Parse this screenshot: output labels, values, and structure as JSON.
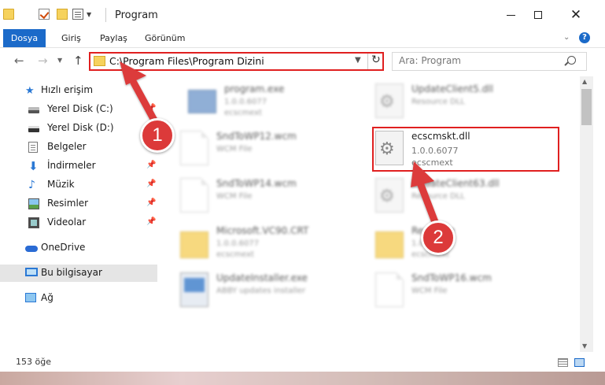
{
  "window": {
    "title": "Program"
  },
  "ribbon": {
    "tabs": [
      "Dosya",
      "Giriş",
      "Paylaş",
      "Görünüm"
    ]
  },
  "address": {
    "path": "C:\\Program Files\\Program Dizini"
  },
  "search": {
    "placeholder": "Ara: Program"
  },
  "sidebar": {
    "items": [
      {
        "label": "Hızlı erişim",
        "icon": "star-icon"
      },
      {
        "label": "Yerel Disk (C:)",
        "icon": "disk-icon"
      },
      {
        "label": "Yerel Disk (D:)",
        "icon": "disk-icon"
      },
      {
        "label": "Belgeler",
        "icon": "documents-icon"
      },
      {
        "label": "İndirmeler",
        "icon": "downloads-icon"
      },
      {
        "label": "Müzik",
        "icon": "music-icon"
      },
      {
        "label": "Resimler",
        "icon": "pictures-icon"
      },
      {
        "label": "Videolar",
        "icon": "videos-icon"
      },
      {
        "label": "OneDrive",
        "icon": "cloud-icon"
      },
      {
        "label": "Bu bilgisayar",
        "icon": "computer-icon"
      },
      {
        "label": "Ağ",
        "icon": "network-icon"
      }
    ]
  },
  "files": [
    {
      "name": "program.exe",
      "line2": "1.0.0.6077",
      "line3": "ecscmext"
    },
    {
      "name": "UpdateClient5.dll",
      "line2": "Resource DLL",
      "line3": ""
    },
    {
      "name": "SndToWP12.wcm",
      "line2": "WCM File",
      "line3": ""
    },
    {
      "name": "ecscmskt.dll",
      "line2": "1.0.0.6077",
      "line3": "ecscmext"
    },
    {
      "name": "SndToWP14.wcm",
      "line2": "WCM File",
      "line3": ""
    },
    {
      "name": "UpdateClient63.dll",
      "line2": "Resource DLL",
      "line3": ""
    },
    {
      "name": "Microsoft.VC90.CRT",
      "line2": "1.0.0.6077",
      "line3": "ecscmext"
    },
    {
      "name": "Resource",
      "line2": "1.0.0.6077",
      "line3": "ecscmext"
    },
    {
      "name": "UpdateInstaller.exe",
      "line2": "ABBY updates installer",
      "line3": ""
    },
    {
      "name": "SndToWP16.wcm",
      "line2": "WCM File",
      "line3": ""
    }
  ],
  "status": {
    "item_count": "153 öğe"
  },
  "annotations": {
    "step1": "1",
    "step2": "2"
  },
  "colors": {
    "accent": "#1b6ac9",
    "highlight": "#e02020",
    "badge": "#dc3a3a"
  }
}
